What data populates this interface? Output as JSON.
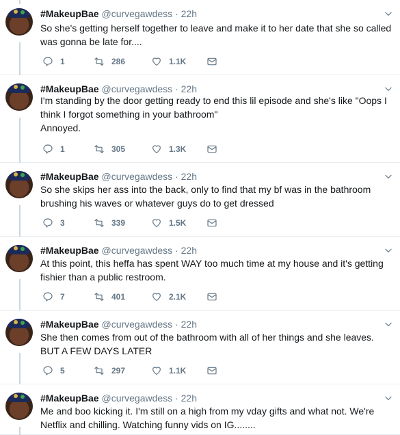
{
  "tweets": [
    {
      "name": "#MakeupBae",
      "handle": "@curvegawdess",
      "time": "· 22h",
      "text": "So she's getting herself together to leave and make it to her date that she so called was gonna be late for....",
      "replies": "1",
      "retweets": "286",
      "likes": "1.1K"
    },
    {
      "name": "#MakeupBae",
      "handle": "@curvegawdess",
      "time": "· 22h",
      "text": "I'm standing by the door getting ready to end this lil episode and she's like \"Oops I think I forgot something in your bathroom\"\nAnnoyed.",
      "replies": "1",
      "retweets": "305",
      "likes": "1.3K"
    },
    {
      "name": "#MakeupBae",
      "handle": "@curvegawdess",
      "time": "· 22h",
      "text": "So she skips her ass into the back, only to find that my bf was in the bathroom brushing his waves or whatever guys do to get dressed",
      "replies": "3",
      "retweets": "339",
      "likes": "1.5K"
    },
    {
      "name": "#MakeupBae",
      "handle": "@curvegawdess",
      "time": "· 22h",
      "text": "At this point, this heffa has spent WAY too much time at my house and it's getting fishier than a public restroom.",
      "replies": "7",
      "retweets": "401",
      "likes": "2.1K"
    },
    {
      "name": "#MakeupBae",
      "handle": "@curvegawdess",
      "time": "· 22h",
      "text": "She then comes from out of the bathroom with all of her things and she leaves.\nBUT A FEW DAYS LATER",
      "replies": "5",
      "retweets": "297",
      "likes": "1.1K"
    },
    {
      "name": "#MakeupBae",
      "handle": "@curvegawdess",
      "time": "· 22h",
      "text": "Me and boo kicking it. I'm still on a high from my vday gifts and what not. We're Netflix and chilling. Watching funny vids on IG........",
      "replies": "",
      "retweets": "",
      "likes": ""
    }
  ],
  "colors": {
    "muted": "#657786",
    "thread_line": "#ccd6dd",
    "text": "#14171a"
  },
  "icons": {
    "reply": "reply-icon",
    "retweet": "retweet-icon",
    "like": "heart-icon",
    "dm": "envelope-icon",
    "menu": "chevron-down-icon"
  }
}
